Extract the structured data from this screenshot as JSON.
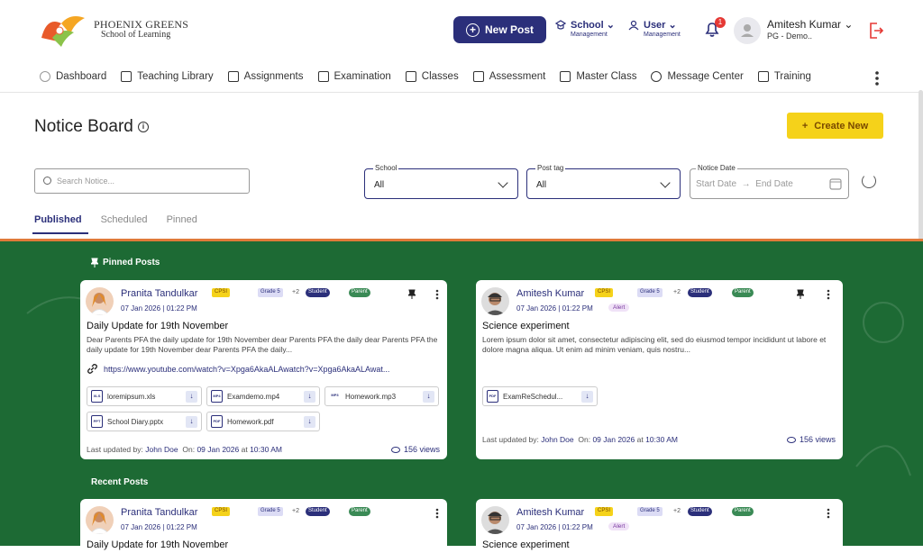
{
  "brand": {
    "name": "PHOENIX GREENS",
    "tagline": "School of Learning"
  },
  "header": {
    "new_post": "New Post",
    "school_mgmt": {
      "title": "School",
      "sub": "Management"
    },
    "user_mgmt": {
      "title": "User",
      "sub": "Management"
    },
    "notification_count": "1",
    "user_name": "Amitesh Kumar",
    "user_role": "PG - Demo.."
  },
  "menu": [
    "Dashboard",
    "Teaching Library",
    "Assignments",
    "Examination",
    "Classes",
    "Assessment",
    "Master Class",
    "Message Center",
    "Training"
  ],
  "page": {
    "title": "Notice Board",
    "create_label": "Create New"
  },
  "filters": {
    "search_placeholder": "Search Notice...",
    "school": {
      "label": "School",
      "value": "All"
    },
    "post_tag": {
      "label": "Post tag",
      "value": "All"
    },
    "notice_date": {
      "label": "Notice Date",
      "start": "Start Date",
      "arrow": "→",
      "end": "End Date"
    }
  },
  "tabs": [
    "Published",
    "Scheduled",
    "Pinned"
  ],
  "sections": {
    "pinned": "Pinned Posts",
    "recent": "Recent Posts"
  },
  "posts": [
    {
      "author": "Pranita Tandulkar",
      "role_tag": "CPSI",
      "grade": "Grade 5",
      "extra": "+2",
      "tags": [
        "Student",
        "Parent"
      ],
      "date": "07 Jan 2026 | 01:22 PM",
      "title": "Daily Update for 19th November",
      "body": "Dear Parents PFA the daily update for 19th November dear Parents PFA the daily dear Parents PFA the daily update for 19th November dear Parents PFA the daily...",
      "link": "https://www.youtube.com/watch?v=Xpga6AkaALAwatch?v=Xpga6AkaALAwat...",
      "attachments": [
        {
          "name": "loremipsum.xls",
          "type": "XLS"
        },
        {
          "name": "Examdemo.mp4",
          "type": "MP4"
        },
        {
          "name": "Homework.mp3",
          "type": "MP3"
        },
        {
          "name": "School Diary.pptx",
          "type": "PPT"
        },
        {
          "name": "Homework.pdf",
          "type": "PDF"
        }
      ],
      "updated_prefix": "Last updated by:",
      "updated_by": "John Doe",
      "on_prefix": "On:",
      "updated_date": "09 Jan 2026",
      "at_word": "at",
      "updated_time": "10:30 AM",
      "views": "156 views"
    },
    {
      "author": "Amitesh Kumar",
      "role_tag": "CPSI",
      "grade": "Grade 5",
      "extra": "+2",
      "tags": [
        "Student",
        "Parent"
      ],
      "date": "07 Jan 2026 | 01:22 PM",
      "alert": "Alert",
      "title": "Science experiment",
      "body": "Lorem ipsum dolor sit amet, consectetur adipiscing elit, sed do eiusmod tempor incididunt ut labore et dolore magna aliqua. Ut enim ad minim veniam, quis nostru...",
      "attachments": [
        {
          "name": "ExamReSchedul...",
          "type": "PDF"
        }
      ],
      "updated_prefix": "Last updated by:",
      "updated_by": "John Doe",
      "on_prefix": "On:",
      "updated_date": "09 Jan 2026",
      "at_word": "at",
      "updated_time": "10:30 AM",
      "views": "156 views"
    }
  ],
  "recent": [
    {
      "author": "Pranita Tandulkar",
      "role_tag": "CPSI",
      "grade": "Grade 5",
      "extra": "+2",
      "tags": [
        "Student",
        "Parent"
      ],
      "date": "07 Jan 2026 | 01:22 PM",
      "title": "Daily Update for 19th November"
    },
    {
      "author": "Amitesh Kumar",
      "role_tag": "CPSI",
      "grade": "Grade 5",
      "extra": "+2",
      "tags": [
        "Student",
        "Parent"
      ],
      "date": "07 Jan 2026 | 01:22 PM",
      "alert": "Alert",
      "title": "Science experiment"
    }
  ],
  "colors": {
    "primary": "#2b2f7a",
    "accent": "#f5d21a",
    "board": "#1d6a34"
  }
}
